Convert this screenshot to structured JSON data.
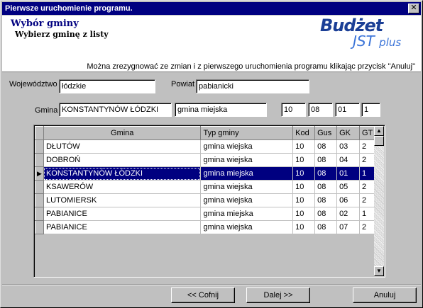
{
  "window": {
    "title": "Pierwsze uruchomienie programu."
  },
  "header": {
    "title": "Wybór gminy",
    "subtitle": "Wybierz gminę z listy",
    "note": "Można zrezygnować ze zmian  i z pierwszego uruchomienia programu klikając przycisk \"Anuluj\"",
    "logo_top": "Budżet",
    "logo_bottom": "JST",
    "logo_plus": "plus"
  },
  "form": {
    "wojewodztwo_label": "Województwo",
    "wojewodztwo_value": "łódzkie",
    "powiat_label": "Powiat",
    "powiat_value": "pabianicki",
    "gmina_label": "Gmina",
    "gmina_value": "KONSTANTYNÓW ŁÓDZKI",
    "typ_value": "gmina miejska",
    "kod_value": "10",
    "gus_value": "08",
    "gk_value": "01",
    "gt_value": "1"
  },
  "table": {
    "columns": [
      "Gmina",
      "Typ gminy",
      "Kod",
      "Gus",
      "GK",
      "GT"
    ],
    "rows": [
      [
        "DŁUTÓW",
        "gmina wiejska",
        "10",
        "08",
        "03",
        "2"
      ],
      [
        "DOBROŃ",
        "gmina wiejska",
        "10",
        "08",
        "04",
        "2"
      ],
      [
        "KONSTANTYNÓW ŁÓDZKI",
        "gmina miejska",
        "10",
        "08",
        "01",
        "1"
      ],
      [
        "KSAWERÓW",
        "gmina wiejska",
        "10",
        "08",
        "05",
        "2"
      ],
      [
        "LUTOMIERSK",
        "gmina wiejska",
        "10",
        "08",
        "06",
        "2"
      ],
      [
        "PABIANICE",
        "gmina miejska",
        "10",
        "08",
        "02",
        "1"
      ],
      [
        "PABIANICE",
        "gmina wiejska",
        "10",
        "08",
        "07",
        "2"
      ]
    ],
    "selected_index": 2
  },
  "buttons": {
    "back": "<< Cofnij",
    "next": "Dalej >>",
    "cancel": "Anuluj"
  }
}
